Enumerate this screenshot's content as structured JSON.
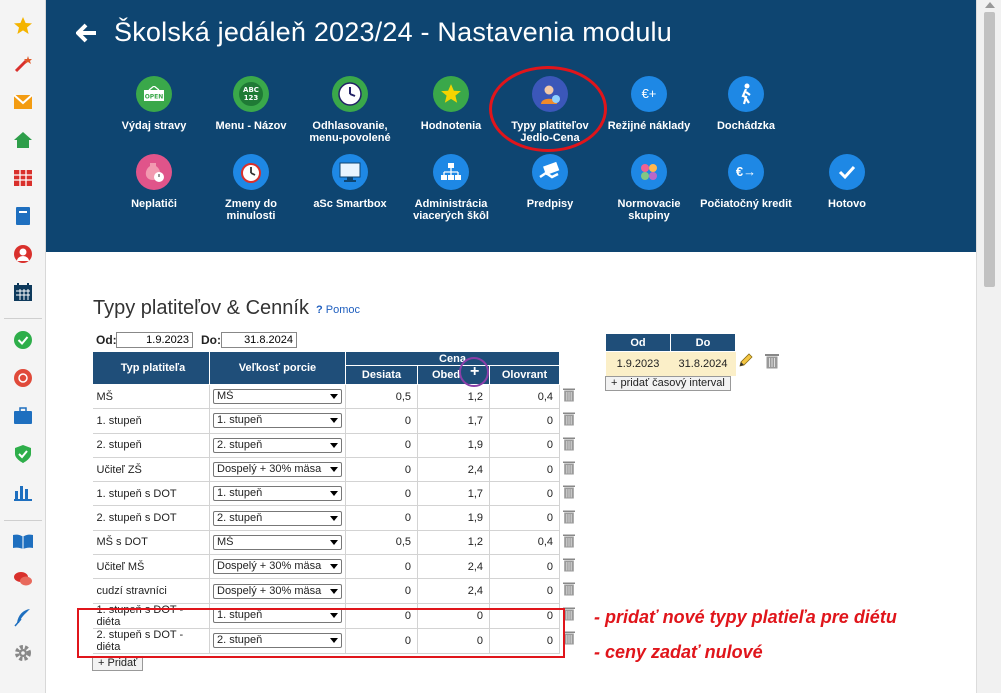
{
  "header": {
    "title": "Školská jedáleň  2023/24 - Nastavenia modulu",
    "modules_row1": [
      {
        "label": "Výdaj stravy",
        "icon": "open-sign-icon",
        "color": "#3aa84a"
      },
      {
        "label": "Menu - Názov",
        "icon": "abc-123-icon",
        "color": "#3aa84a"
      },
      {
        "label": "Odhlasovanie, menu-povolené",
        "icon": "clock-icon",
        "color": "#3aa84a"
      },
      {
        "label": "Hodnotenia",
        "icon": "star-icon",
        "color": "#3aa84a"
      },
      {
        "label": "Typy platiteľov Jedlo-Cena",
        "icon": "payer-person-icon",
        "color": "#3b57b9"
      },
      {
        "label": "Režijné náklady",
        "icon": "euro-plus-icon",
        "color": "#1e88e5"
      },
      {
        "label": "Dochádzka",
        "icon": "walking-person-icon",
        "color": "#1e88e5"
      }
    ],
    "modules_row2": [
      {
        "label": "Neplatiči",
        "icon": "money-bag-clock-icon",
        "color": "#e0548a"
      },
      {
        "label": "Zmeny do minulosti",
        "icon": "alarm-clock-icon",
        "color": "#1e88e5"
      },
      {
        "label": "aSc Smartbox",
        "icon": "monitor-icon",
        "color": "#1e88e5"
      },
      {
        "label": "Administrácia viacerých škôl",
        "icon": "org-chart-icon",
        "color": "#1e88e5"
      },
      {
        "label": "Predpisy",
        "icon": "money-handshake-icon",
        "color": "#1e88e5"
      },
      {
        "label": "Normovacie skupiny",
        "icon": "groups-dots-icon",
        "color": "#1e88e5"
      },
      {
        "label": "Počiatočný kredit",
        "icon": "euro-arrow-icon",
        "color": "#1e88e5"
      },
      {
        "label": "Hotovo",
        "icon": "checkmark-icon",
        "color": "#1e88e5"
      }
    ]
  },
  "section": {
    "title": "Typy platiteľov & Cenník",
    "help": "Pomoc",
    "help_mark": "?",
    "od_label": "Od:",
    "od_value": "1.9.2023",
    "do_label": "Do:",
    "do_value": "31.8.2024"
  },
  "table": {
    "headers": {
      "typ": "Typ platiteľa",
      "velkost": "Veľkosť porcie",
      "cena": "Cena",
      "desiata": "Desiata",
      "obed": "Obed",
      "olovrant": "Olovrant",
      "plus": "+"
    },
    "rows": [
      {
        "typ": "MŠ",
        "velkost": "MŠ",
        "desiata": "0,5",
        "obed": "1,2",
        "olovrant": "0,4"
      },
      {
        "typ": "1. stupeň",
        "velkost": "1. stupeň",
        "desiata": "0",
        "obed": "1,7",
        "olovrant": "0"
      },
      {
        "typ": "2. stupeň",
        "velkost": "2. stupeň",
        "desiata": "0",
        "obed": "1,9",
        "olovrant": "0"
      },
      {
        "typ": "Učiteľ ZŠ",
        "velkost": "Dospelý + 30% mäsa",
        "desiata": "0",
        "obed": "2,4",
        "olovrant": "0"
      },
      {
        "typ": "1. stupeň s DOT",
        "velkost": "1. stupeň",
        "desiata": "0",
        "obed": "1,7",
        "olovrant": "0"
      },
      {
        "typ": "2. stupeň s DOT",
        "velkost": "2. stupeň",
        "desiata": "0",
        "obed": "1,9",
        "olovrant": "0"
      },
      {
        "typ": "MŠ s DOT",
        "velkost": "MŠ",
        "desiata": "0,5",
        "obed": "1,2",
        "olovrant": "0,4"
      },
      {
        "typ": "Učiteľ MŠ",
        "velkost": "Dospelý + 30% mäsa",
        "desiata": "0",
        "obed": "2,4",
        "olovrant": "0"
      },
      {
        "typ": "cudzí stravníci",
        "velkost": "Dospelý + 30% mäsa",
        "desiata": "0",
        "obed": "2,4",
        "olovrant": "0"
      },
      {
        "typ": "1. stupeň s DOT - diéta",
        "velkost": "1. stupeň",
        "desiata": "0",
        "obed": "0",
        "olovrant": "0"
      },
      {
        "typ": "2. stupeň s DOT - diéta",
        "velkost": "2. stupeň",
        "desiata": "0",
        "obed": "0",
        "olovrant": "0"
      }
    ],
    "add_button": "+ Pridať"
  },
  "intervals": {
    "headers": {
      "od": "Od",
      "do": "Do"
    },
    "rows": [
      {
        "od": "1.9.2023",
        "do": "31.8.2024"
      }
    ],
    "add_button": "+ pridať časový interval"
  },
  "annotations": {
    "note1": "- pridať nové typy platieľa pre diétu",
    "note2": "- ceny zadať nulové",
    "highlight_color": "#e0151b"
  },
  "sidebar": {
    "icons": [
      "star-icon",
      "magic-wand-icon",
      "mail-icon",
      "home-icon",
      "timetable-icon",
      "book-icon",
      "person-icon",
      "calendar-icon",
      "check-shield-icon",
      "sports-icon",
      "briefcase-icon",
      "security-shield-icon",
      "bar-chart-icon",
      "open-book-icon",
      "chat-icon",
      "feather-icon",
      "settings-gear-icon"
    ]
  }
}
